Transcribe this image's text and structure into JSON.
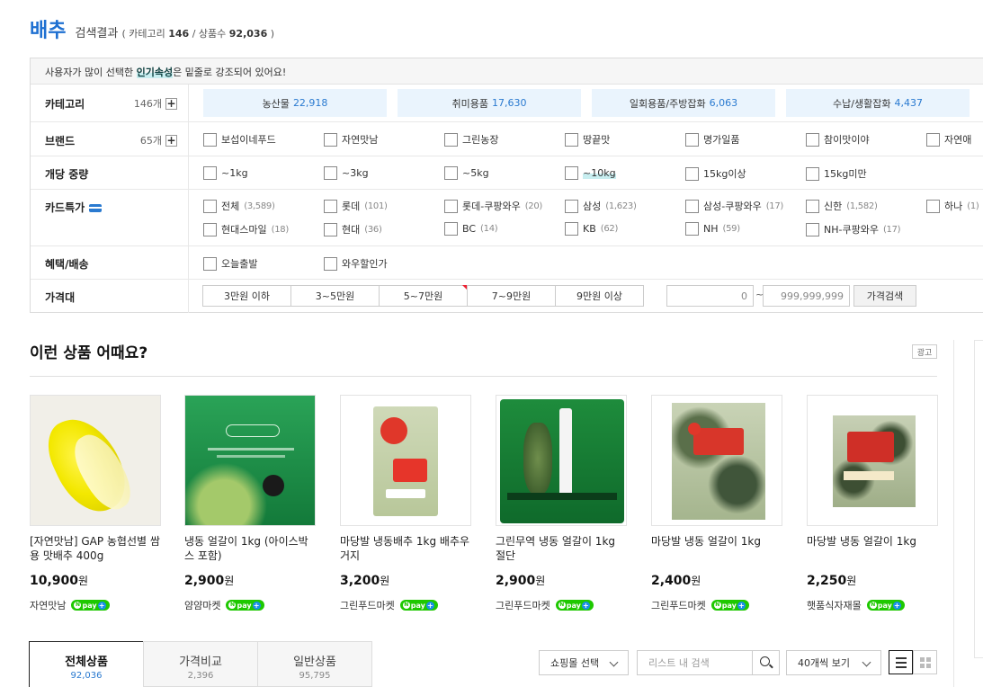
{
  "header": {
    "keyword": "배추",
    "result_label": "검색결과",
    "paren_open": "( 카테고리",
    "category_count": "146",
    "sep": "/ 상품수",
    "product_count": "92,036",
    "paren_close": ")"
  },
  "filter": {
    "notice_pre": "사용자가 많이 선택한 ",
    "notice_hl": "인기속성",
    "notice_post": "은 밑줄로 강조되어 있어요!",
    "category": {
      "label": "카테고리",
      "count": "146개",
      "items": [
        {
          "name": "농산물",
          "count": "22,918"
        },
        {
          "name": "취미용품",
          "count": "17,630"
        },
        {
          "name": "일회용품/주방잡화",
          "count": "6,063"
        },
        {
          "name": "수납/생활잡화",
          "count": "4,437"
        }
      ]
    },
    "brand": {
      "label": "브랜드",
      "count": "65개",
      "items": [
        "보섭이네푸드",
        "자연맛남",
        "그린농장",
        "땅끝맛",
        "명가일품",
        "참이맛이야",
        "자연애"
      ]
    },
    "weight": {
      "label": "개당 중량",
      "items": [
        "~1kg",
        "~3kg",
        "~5kg",
        "~10kg",
        "15kg이상",
        "15kg미만"
      ]
    },
    "card": {
      "label": "카드특가",
      "row1": [
        {
          "name": "전체",
          "count": "(3,589)"
        },
        {
          "name": "롯데",
          "count": "(101)"
        },
        {
          "name": "롯데-쿠팡와우",
          "count": "(20)"
        },
        {
          "name": "삼성",
          "count": "(1,623)"
        },
        {
          "name": "삼성-쿠팡와우",
          "count": "(17)"
        },
        {
          "name": "신한",
          "count": "(1,582)"
        },
        {
          "name": "하나",
          "count": "(1)"
        }
      ],
      "row2": [
        {
          "name": "현대스마일",
          "count": "(18)"
        },
        {
          "name": "현대",
          "count": "(36)"
        },
        {
          "name": "BC",
          "count": "(14)"
        },
        {
          "name": "KB",
          "count": "(62)"
        },
        {
          "name": "NH",
          "count": "(59)"
        },
        {
          "name": "NH-쿠팡와우",
          "count": "(17)"
        }
      ]
    },
    "benefit": {
      "label": "혜택/배송",
      "items": [
        "오늘출발",
        "와우할인가"
      ]
    },
    "price": {
      "label": "가격대",
      "ranges": [
        "3만원 이하",
        "3~5만원",
        "5~7만원",
        "7~9만원",
        "9만원 이상"
      ],
      "min_placeholder": "0",
      "max_placeholder": "999,999,999",
      "dash": "~",
      "search_label": "가격검색"
    }
  },
  "recommend": {
    "title": "이런 상품 어때요?",
    "ad_label": "광고",
    "currency": "원",
    "products": [
      {
        "name": "[자연맛남] GAP 농협선별 쌈용 맛배추 400g",
        "price": "10,900",
        "shop": "자연맛남"
      },
      {
        "name": "냉동 얼갈이 1kg (아이스박스 포함)",
        "price": "2,900",
        "shop": "얌얌마켓"
      },
      {
        "name": "마당발 냉동배추 1kg 배추우거지",
        "price": "3,200",
        "shop": "그린푸드마켓"
      },
      {
        "name": "그린무역 냉동 얼갈이 1kg 절단",
        "price": "2,900",
        "shop": "그린푸드마켓"
      },
      {
        "name": "마당발 냉동 얼갈이 1kg",
        "price": "2,400",
        "shop": "그린푸드마켓"
      },
      {
        "name": "마당발 냉동 얼갈이 1kg",
        "price": "2,250",
        "shop": "햇품식자재몰"
      }
    ],
    "pay_label": "pay"
  },
  "tabs": [
    {
      "label": "전체상품",
      "count": "92,036"
    },
    {
      "label": "가격비교",
      "count": "2,396"
    },
    {
      "label": "일반상품",
      "count": "95,795"
    }
  ],
  "controls": {
    "mall_select": "쇼핑몰 선택",
    "list_search_placeholder": "리스트 내 검색",
    "page_size": "40개씩 보기"
  }
}
